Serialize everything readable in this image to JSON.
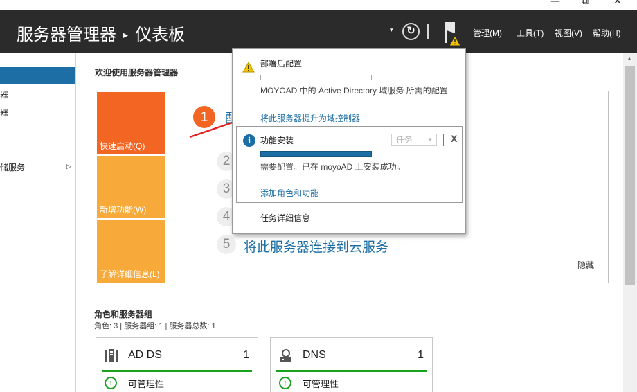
{
  "window": {
    "minimize_glyph": "—",
    "restore_glyph": "⧉",
    "close_glyph": "✕"
  },
  "header": {
    "app_title": "服务器管理器",
    "separator": "▸",
    "page_title": "仪表板",
    "refresh_glyph": "↻",
    "dropdown_glyph": "▾",
    "menus": [
      "管理(M)",
      "工具(T)",
      "视图(V)",
      "帮助(H)"
    ]
  },
  "nav": {
    "items": [
      "器",
      "器",
      "",
      "储服务"
    ],
    "expand_glyph": "▷"
  },
  "welcome": {
    "title": "欢迎使用服务器管理器",
    "tiles": [
      "快速启动(Q)",
      "新增功能(W)",
      "了解详细信息(L)"
    ],
    "steps": [
      {
        "num": "1",
        "text": "配"
      },
      {
        "num": "2",
        "text": ""
      },
      {
        "num": "3",
        "text": ""
      },
      {
        "num": "4",
        "text": ""
      },
      {
        "num": "5",
        "text": "将此服务器连接到云服务"
      }
    ],
    "hide_label": "隐藏"
  },
  "roles": {
    "title": "角色和服务器组",
    "meta": "角色: 3 | 服务器组: 1 | 服务器总数: 1",
    "cards": [
      {
        "name": "AD DS",
        "count": "1",
        "status": "可管理性",
        "icon": "server-role-icon"
      },
      {
        "name": "DNS",
        "count": "1",
        "status": "可管理性",
        "icon": "dns-role-icon"
      }
    ],
    "status_glyph": "↑"
  },
  "popup": {
    "deploy_title": "部署后配置",
    "deploy_message": "MOYOAD 中的 Active Directory 域服务 所需的配置",
    "promote_link": "将此服务器提升为域控制器",
    "feature_title": "功能安装",
    "task_dropdown": "任务",
    "close_glyph": "X",
    "feature_message": "需要配置。已在 moyoAD 上安装成功。",
    "add_roles_link": "添加角色和功能",
    "task_details_link": "任务详细信息",
    "info_glyph": "i",
    "caret_glyph": "▼"
  },
  "colors": {
    "header_bg": "#2b2b2b",
    "accent_blue": "#1c6ea4",
    "quick_start_orange": "#f26522",
    "tile_amber": "#f7a939",
    "status_green": "#19a31c",
    "warning_yellow": "#f5c400",
    "arrow_red": "#e02020"
  },
  "progress": {
    "deploy_fraction": 0,
    "feature_fraction": 1
  }
}
